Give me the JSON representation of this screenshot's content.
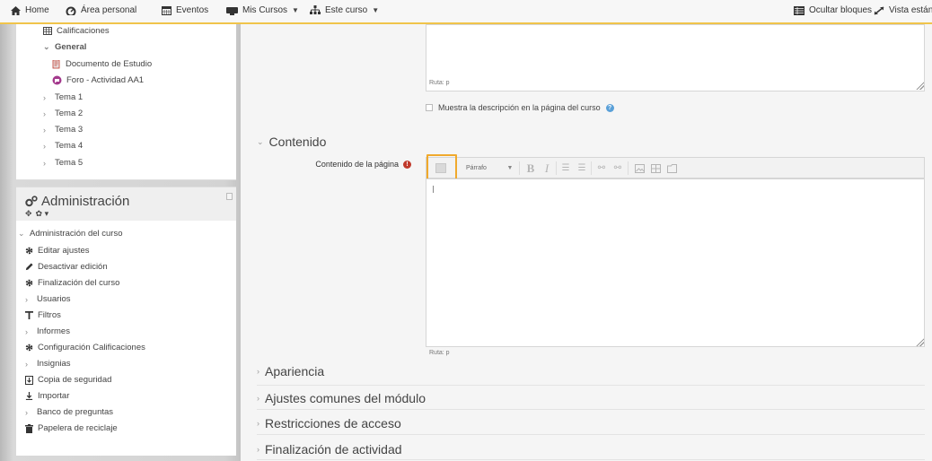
{
  "navbar": {
    "home": "Home",
    "personal_area": "Área personal",
    "events": "Eventos",
    "my_courses": "Mis Cursos",
    "this_course": "Este curso",
    "hide_blocks": "Ocultar bloques",
    "standard_view": "Vista estánda"
  },
  "nav_tree": {
    "grades": "Calificaciones",
    "general": "General",
    "study_doc": "Documento de Estudio",
    "forum": "Foro - Actividad AA1",
    "topics": [
      "Tema 1",
      "Tema 2",
      "Tema 3",
      "Tema 4",
      "Tema 5"
    ]
  },
  "admin": {
    "title": "Administración",
    "course_admin": "Administración del curso",
    "items": [
      "Editar ajustes",
      "Desactivar edición",
      "Finalización del curso",
      "Usuarios",
      "Filtros",
      "Informes",
      "Configuración Calificaciones",
      "Insignias",
      "Copia de seguridad",
      "Importar",
      "Banco de preguntas",
      "Papelera de reciclaje"
    ]
  },
  "main": {
    "ruta_top": "Ruta: p",
    "show_description": "Muestra la descripción en la página del curso",
    "content_section": "Contenido",
    "content_label": "Contenido de la página",
    "paragraph_select": "Párrafo",
    "ruta_bottom": "Ruta: p",
    "sections": [
      "Apariencia",
      "Ajustes comunes del módulo",
      "Restricciones de acceso",
      "Finalización de actividad"
    ]
  },
  "colors": {
    "highlight": "#f0a92c",
    "navbar_border": "#f0c44a",
    "required": "#c0392b",
    "info": "#5aa0d8"
  }
}
